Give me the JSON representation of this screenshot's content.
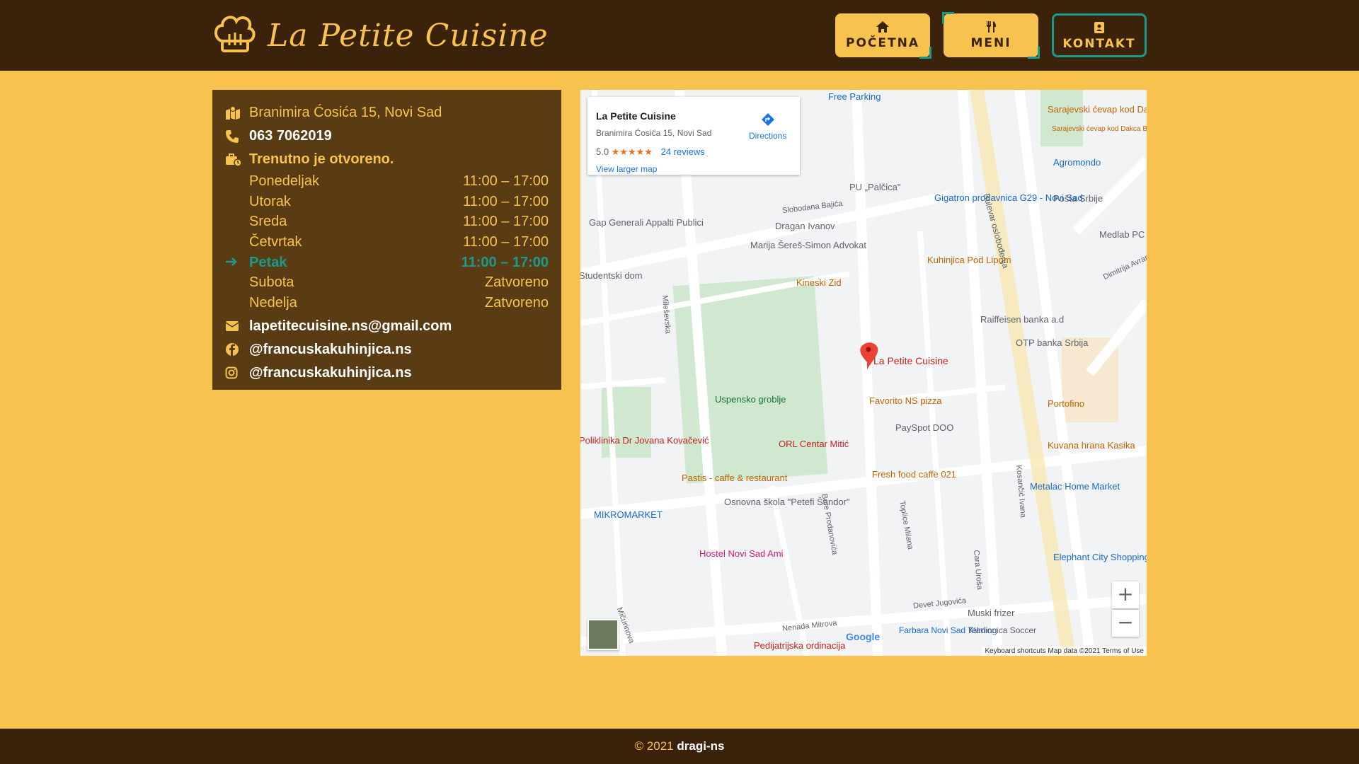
{
  "header": {
    "brand": "La Petite Cuisine",
    "nav": [
      {
        "label": "POČETNA",
        "icon": "home-icon"
      },
      {
        "label": "MENI",
        "icon": "utensils-icon"
      },
      {
        "label": "KONTAKT",
        "icon": "contact-card-icon"
      }
    ]
  },
  "contact": {
    "address": "Branimira Ćosića 15, Novi Sad",
    "phone": "063 7062019",
    "status": "Trenutno je otvoreno.",
    "hours": [
      {
        "day": "Ponedeljak",
        "time": "11:00 – 17:00"
      },
      {
        "day": "Utorak",
        "time": "11:00 – 17:00"
      },
      {
        "day": "Sreda",
        "time": "11:00 – 17:00"
      },
      {
        "day": "Četvrtak",
        "time": "11:00 – 17:00"
      },
      {
        "day": "Petak",
        "time": "11:00 – 17:00"
      },
      {
        "day": "Subota",
        "time": "Zatvoreno"
      },
      {
        "day": "Nedelja",
        "time": "Zatvoreno"
      }
    ],
    "email": "lapetitecuisine.ns@gmail.com",
    "facebook": "@francuskakuhinjica.ns",
    "instagram": "@francuskakuhinjica.ns"
  },
  "map": {
    "card": {
      "title": "La Petite Cuisine",
      "address": "Branimira Ćosića 15, Novi Sad",
      "rating": "5.0",
      "stars": "★★★★★",
      "reviews": "24 reviews",
      "directions": "Directions",
      "larger": "View larger map"
    },
    "pin_label": "La Petite Cuisine",
    "labels": {
      "l1": "Free Parking",
      "l2": "Sarajevski ćevap kod Dakca",
      "l3": "Agromondo",
      "l4": "Pošta Srbije",
      "l5": "Medlab PC",
      "l6": "Gigatron prodavnica G29 - Novi Sad",
      "l7": "PU „Palčica\"",
      "l8": "Dragan Ivanov",
      "l9": "Gap Generali Appalti Publici",
      "l10": "Marija Šereš-Simon Advokat",
      "l11": "Kinеski Zid",
      "l12": "Kuhinjica Pod Lipom",
      "l13": "Raiffeisen banka a.d",
      "l14": "OTP banka Srbija",
      "l15": "Uspensko groblje",
      "l16": "Favorito NS pizza",
      "l17": "PaySpot DOO",
      "l18": "Portofino",
      "l19": "ORL Centar Mitić",
      "l20": "Kuvana hrana Kasika",
      "l21": "Fresh food caffe 021",
      "l22": "Pastis - caffe & restaurant",
      "l23": "Metalac Home Market",
      "l24": "Osnovna škola \"Petefi Šandor\"",
      "l25": "MIKROMARKET",
      "l26": "Hostel Novi Sad Ami",
      "l27": "Elephant City Shopping Center",
      "l28": "Muski frizer",
      "l29": "Pedijatrijska ordinacija",
      "l30": "Farbara Novi Sad Telming",
      "l31": "Kladionica Soccer",
      "l32": "Poliklinika Dr Jovana Kovačević",
      "l33": "Studentski dom",
      "l34": "Bulevar oslobođenja",
      "l35": "Slobodana Bajića",
      "l36": "Dimitrija Avramović",
      "l37": "Mileševska",
      "l38": "Bore Prodanovića",
      "l39": "Toplice Milana",
      "l40": "Kosančić Ivana",
      "l41": "Devet Jugovića",
      "l42": "Nenada Mitrova",
      "l43": "Mičurinova",
      "l44": "Cara Uroša",
      "l45": "Sarajevski ćevap kod Dakca BULEVAR"
    },
    "zoom_in": "+",
    "zoom_out": "−",
    "attribution": "Keyboard shortcuts   Map data ©2021   Terms of Use",
    "google": "Google"
  },
  "footer": {
    "copy": "© 2021",
    "author": "dragi-ns"
  }
}
